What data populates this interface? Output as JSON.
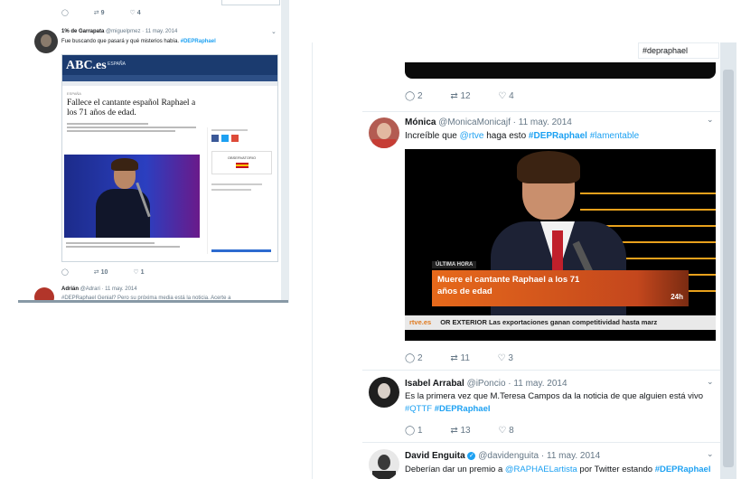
{
  "left": {
    "top_box_text": "",
    "top_actions": {
      "reply": "",
      "retweet": "9",
      "like": "4"
    },
    "tweet1": {
      "name": "1% de Garrapata",
      "handle": "@miguelpmez",
      "date": "11 may. 2014",
      "text_plain": "Fue buscando que pasará y qué misterios había. ",
      "hashtag": "#DEPRaphael"
    },
    "article": {
      "logo": "ABC.es",
      "section": "ESPAÑA",
      "kicker": "ESPAÑA",
      "headline": "Fallece el cantante español Raphael a los 71 años de edad.",
      "side_label": "OBSERVATORIO"
    },
    "tweet1_actions": {
      "reply": "",
      "retweet": "10",
      "like": "1"
    },
    "tweet2": {
      "name": "Adrián",
      "handle": "@Adrari",
      "date": "11 may. 2014",
      "text_plain": "#DEPRaphael Genial? Pero su próxima media está la noticia. Acerte a"
    }
  },
  "right": {
    "search_text": "#depraphael",
    "top_actions": {
      "reply": "2",
      "retweet": "12",
      "like": "4"
    },
    "tweet_monica": {
      "name": "Mónica",
      "handle": "@MonicaMonicajf",
      "date": "11 may. 2014",
      "text_pre": "Increíble que ",
      "mention": "@rtve",
      "text_mid": " haga esto ",
      "hashtag1": "#DEPRaphael",
      "hashtag2": "#lamentable"
    },
    "video": {
      "tag": "ÚLTIMA HORA",
      "lower_third": "Muere el cantante Raphael a los 71 años de edad",
      "clock": "24h",
      "ticker_brand": "rtve.es",
      "ticker_text": "OR EXTERIOR  Las exportaciones ganan competitividad hasta marz"
    },
    "monica_actions": {
      "reply": "2",
      "retweet": "11",
      "like": "3"
    },
    "tweet_isabel": {
      "name": "Isabel Arrabal",
      "handle": "@iPoncio",
      "date": "11 may. 2014",
      "text": "Es la primera vez que M.Teresa Campos da la noticia de que alguien está vivo",
      "hashtag1": "#QTTF",
      "hashtag2": "#DEPRaphael"
    },
    "isabel_actions": {
      "reply": "1",
      "retweet": "13",
      "like": "8"
    },
    "tweet_david": {
      "name": "David Enguita",
      "handle": "@davidenguita",
      "date": "11 may. 2014",
      "text_pre": "Deberían dar un premio a ",
      "mention": "@RAPHAELartista",
      "text_mid": " por Twitter estando ",
      "hashtag": "#DEPRaphael"
    },
    "icons": {
      "reply": "◯",
      "retweet": "⇄",
      "like": "♡",
      "chevron": "⌄",
      "verified": "✓"
    }
  }
}
